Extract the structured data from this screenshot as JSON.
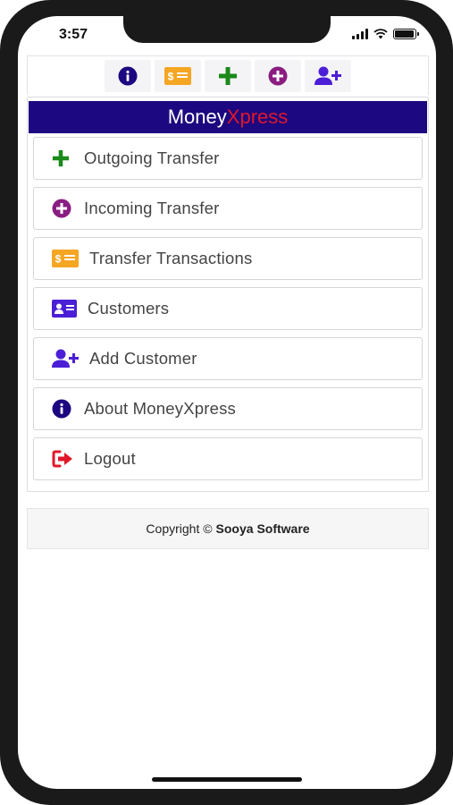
{
  "status_bar": {
    "time": "3:57",
    "battery_level": 0.95
  },
  "toolbar": {
    "buttons": [
      {
        "icon": "info-circle-icon",
        "color": "#1c0880"
      },
      {
        "icon": "money-card-icon",
        "color": "#f5a623"
      },
      {
        "icon": "plus-icon",
        "color": "#1a8a1a"
      },
      {
        "icon": "plus-circle-icon",
        "color": "#8a1d82"
      },
      {
        "icon": "user-plus-icon",
        "color": "#4b1fd6"
      }
    ]
  },
  "brand": {
    "part1": "Money",
    "part2": "Xpress",
    "bg_color": "#1c0880",
    "accent_color": "#e0172a"
  },
  "menu": {
    "items": [
      {
        "label": "Outgoing Transfer",
        "icon": "plus-icon",
        "color": "#1a8a1a"
      },
      {
        "label": "Incoming Transfer",
        "icon": "plus-circle-icon",
        "color": "#8a1d82"
      },
      {
        "label": "Transfer Transactions",
        "icon": "money-card-icon",
        "color": "#f5a623"
      },
      {
        "label": "Customers",
        "icon": "id-card-icon",
        "color": "#4b1fd6"
      },
      {
        "label": "Add Customer",
        "icon": "user-plus-icon",
        "color": "#4b1fd6"
      },
      {
        "label": "About MoneyXpress",
        "icon": "info-circle-icon",
        "color": "#1c0880"
      },
      {
        "label": "Logout",
        "icon": "sign-out-icon",
        "color": "#e0172a"
      }
    ]
  },
  "footer": {
    "prefix": "Copyright ©",
    "company": "Sooya Software"
  }
}
